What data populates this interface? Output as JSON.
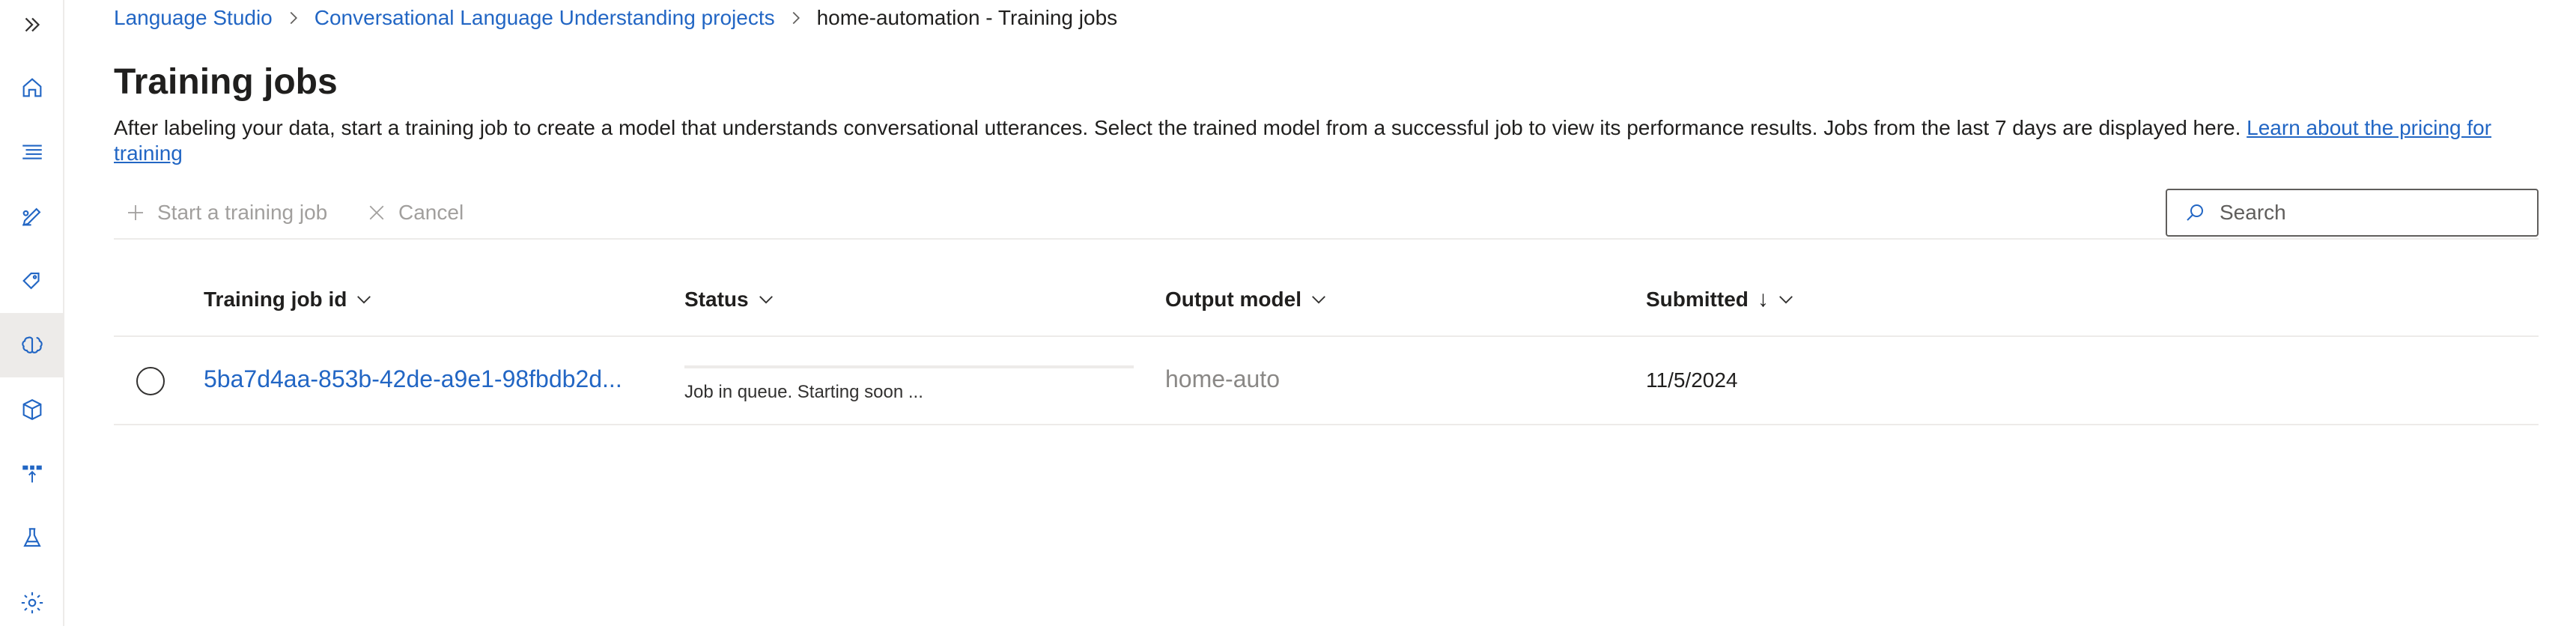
{
  "nav": {
    "items": [
      {
        "name": "expand",
        "icon": "double-chevron-right-icon"
      },
      {
        "name": "home",
        "icon": "home-icon"
      },
      {
        "name": "schema",
        "icon": "list-icon"
      },
      {
        "name": "data-labeling",
        "icon": "pencil-icon"
      },
      {
        "name": "tags",
        "icon": "tag-icon"
      },
      {
        "name": "training-jobs",
        "icon": "brain-icon",
        "selected": true
      },
      {
        "name": "model-performance",
        "icon": "cube-icon"
      },
      {
        "name": "deploying",
        "icon": "deploy-icon"
      },
      {
        "name": "testing",
        "icon": "flask-icon"
      },
      {
        "name": "settings",
        "icon": "gear-icon"
      }
    ]
  },
  "breadcrumb": {
    "items": [
      "Language Studio",
      "Conversational Language Understanding projects",
      "home-automation - Training jobs"
    ]
  },
  "page": {
    "title": "Training jobs",
    "description": "After labeling your data, start a training job to create a model that understands conversational utterances. Select the trained model from a successful job to view its performance results. Jobs from the last 7 days are displayed here. ",
    "learn_link": "Learn about the pricing for training"
  },
  "toolbar": {
    "start_label": "Start a training job",
    "cancel_label": "Cancel",
    "search_placeholder": "Search"
  },
  "table": {
    "columns": [
      "Training job id",
      "Status",
      "Output model",
      "Submitted"
    ],
    "sorted_column": "Submitted",
    "sort_direction": "descending",
    "rows": [
      {
        "job_id": "5ba7d4aa-853b-42de-a9e1-98fbdb2d...",
        "status": "Job in queue. Starting soon ...",
        "progress": 0,
        "output_model": "home-auto",
        "submitted": "11/5/2024"
      }
    ]
  },
  "colors": {
    "link": "#2266c4",
    "text": "#201f1e",
    "disabled": "#a19f9d",
    "divider": "#edebe9",
    "rail_selected": "#edebe9",
    "icon": "#2266c4"
  }
}
